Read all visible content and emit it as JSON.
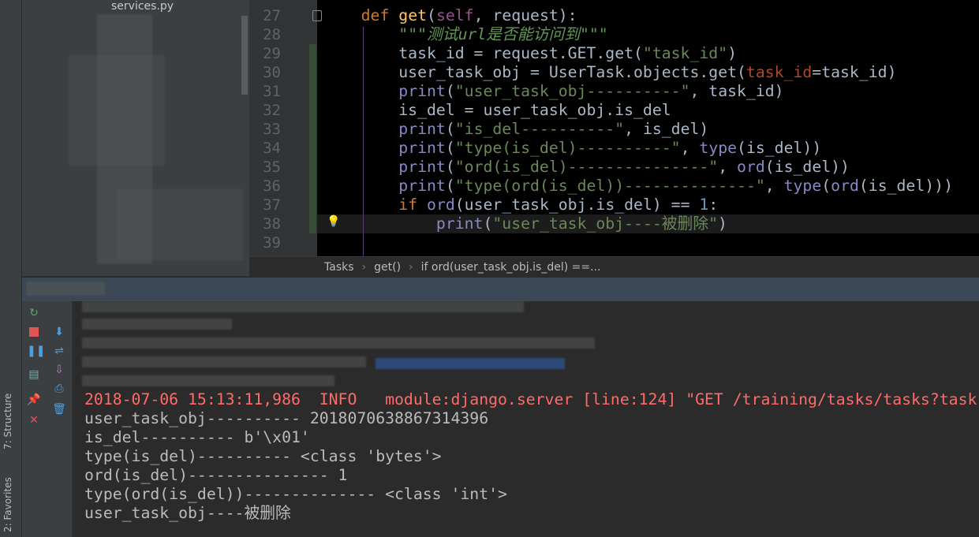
{
  "project": {
    "file_partial": "services.py"
  },
  "editor": {
    "lines": [
      {
        "n": "27",
        "tokens": [
          [
            "    ",
            ""
          ],
          [
            "def",
            "kw"
          ],
          [
            " ",
            ""
          ],
          [
            "get",
            "fn"
          ],
          [
            "(",
            ""
          ],
          [
            "self",
            "self"
          ],
          [
            ", request):",
            ""
          ]
        ]
      },
      {
        "n": "28",
        "tokens": [
          [
            "        ",
            ""
          ],
          [
            "\"\"\"测试url是否能访问到\"\"\"",
            "doc"
          ]
        ]
      },
      {
        "n": "29",
        "tokens": [
          [
            "        task_id = request.GET.get(",
            ""
          ],
          [
            "\"task_id\"",
            "str"
          ],
          [
            ")",
            ""
          ]
        ]
      },
      {
        "n": "30",
        "tokens": [
          [
            "        user_task_obj = UserTask.objects.get(",
            ""
          ],
          [
            "task_id",
            "param"
          ],
          [
            "=task_id)",
            ""
          ]
        ]
      },
      {
        "n": "31",
        "tokens": [
          [
            "        ",
            ""
          ],
          [
            "print",
            "bi"
          ],
          [
            "(",
            ""
          ],
          [
            "\"user_task_obj----------\"",
            "str"
          ],
          [
            ", task_id)",
            ""
          ]
        ]
      },
      {
        "n": "32",
        "tokens": [
          [
            "        is_del = user_task_obj.is_del",
            ""
          ]
        ]
      },
      {
        "n": "33",
        "tokens": [
          [
            "        ",
            ""
          ],
          [
            "print",
            "bi"
          ],
          [
            "(",
            ""
          ],
          [
            "\"is_del----------\"",
            "str"
          ],
          [
            ", is_del)",
            ""
          ]
        ]
      },
      {
        "n": "34",
        "tokens": [
          [
            "        ",
            ""
          ],
          [
            "print",
            "bi"
          ],
          [
            "(",
            ""
          ],
          [
            "\"type(is_del)----------\"",
            "str"
          ],
          [
            ", ",
            ""
          ],
          [
            "type",
            "bi"
          ],
          [
            "(is_del))",
            ""
          ]
        ]
      },
      {
        "n": "35",
        "tokens": [
          [
            "        ",
            ""
          ],
          [
            "print",
            "bi"
          ],
          [
            "(",
            ""
          ],
          [
            "\"ord(is_del)---------------\"",
            "str"
          ],
          [
            ", ",
            ""
          ],
          [
            "ord",
            "bi"
          ],
          [
            "(is_del))",
            ""
          ]
        ]
      },
      {
        "n": "36",
        "tokens": [
          [
            "        ",
            ""
          ],
          [
            "print",
            "bi"
          ],
          [
            "(",
            ""
          ],
          [
            "\"type(ord(is_del))--------------\"",
            "str"
          ],
          [
            ", ",
            ""
          ],
          [
            "type",
            "bi"
          ],
          [
            "(",
            ""
          ],
          [
            "ord",
            "bi"
          ],
          [
            "(is_del)))",
            ""
          ]
        ]
      },
      {
        "n": "37",
        "tokens": [
          [
            "        ",
            ""
          ],
          [
            "if",
            "kw"
          ],
          [
            " ",
            ""
          ],
          [
            "ord",
            "bi"
          ],
          [
            "(user_task_obj.is_del) == ",
            ""
          ],
          [
            "1",
            "num"
          ],
          [
            ":",
            ""
          ]
        ]
      },
      {
        "n": "38",
        "tokens": [
          [
            "            ",
            ""
          ],
          [
            "print",
            "bi"
          ],
          [
            "(",
            ""
          ],
          [
            "\"user_task_obj----被删除\"",
            "str"
          ],
          [
            ")",
            ""
          ]
        ]
      },
      {
        "n": "39",
        "tokens": []
      }
    ]
  },
  "breadcrumb": [
    "Tasks",
    "get()",
    "if ord(user_task_obj.is_del) ==..."
  ],
  "console": {
    "log_line": "2018-07-06 15:13:11,986  INFO   module:django.server [line:124] \"GET /training/tasks/tasks?task",
    "output": [
      "user_task_obj---------- 2018070638867314396",
      "is_del---------- b'\\x01'",
      "type(is_del)---------- <class 'bytes'>",
      "ord(is_del)--------------- 1",
      "type(ord(is_del))-------------- <class 'int'>",
      "user_task_obj----被删除"
    ]
  },
  "side_tabs": {
    "structure": "7: Structure",
    "favorites": "2: Favorites"
  },
  "colors": {
    "error": "#ff6b68",
    "editor_bg": "#000000",
    "console_bg": "#2b2b2b"
  }
}
